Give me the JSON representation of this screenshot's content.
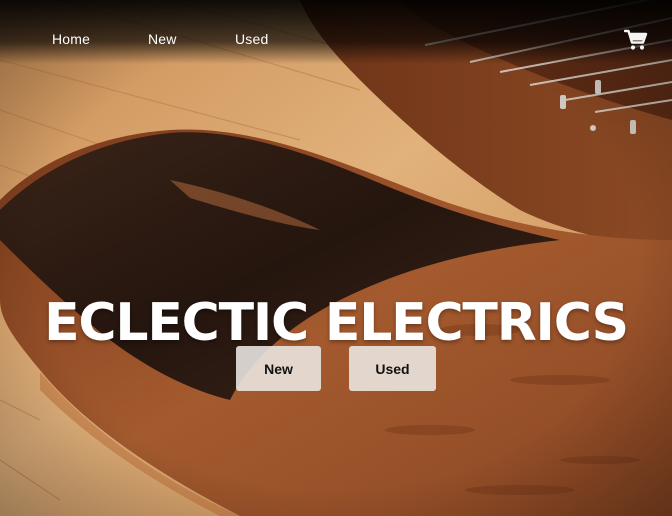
{
  "nav": {
    "home_label": "Home",
    "new_label": "New",
    "used_label": "Used",
    "cart_icon": "shopping-cart-icon"
  },
  "hero": {
    "title": "ECLECTIC ELECTRICS",
    "buttons": {
      "new_label": "New",
      "used_label": "Used"
    }
  },
  "colors": {
    "nav_text": "#ffffff",
    "title_text": "#ffffff",
    "button_bg": "#ece8e4",
    "button_text": "#111111",
    "wood_light": "#d9a46e",
    "wood_body": "#8a4a26",
    "ebony": "#2c1a12"
  }
}
